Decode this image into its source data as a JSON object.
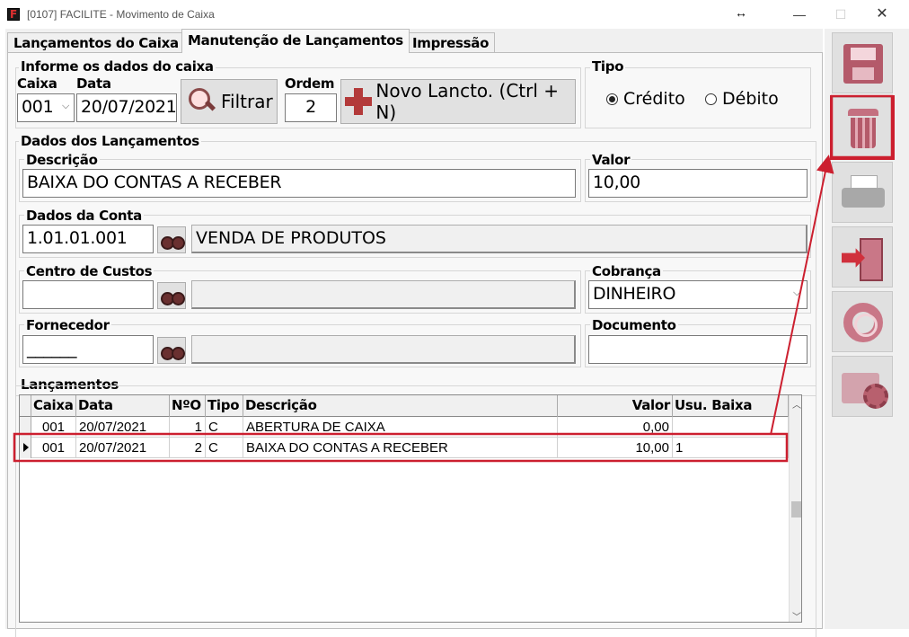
{
  "window": {
    "title": "[0107] FACILITE - Movimento de Caixa",
    "resize_glyph": "↔",
    "minimize": "—",
    "maximize": "☐",
    "close": "✕"
  },
  "tabs": [
    {
      "label": "Lançamentos do Caixa",
      "active": false
    },
    {
      "label": "Manutenção de Lançamentos",
      "active": true
    },
    {
      "label": "Impressão",
      "active": false
    }
  ],
  "caixa_group": {
    "legend": "Informe os dados do caixa",
    "caixa_label": "Caixa",
    "caixa_value": "001",
    "data_label": "Data",
    "data_value": "20/07/2021",
    "filter_button": "Filtrar",
    "ordem_label": "Ordem",
    "ordem_value": "2",
    "new_button": "Novo Lancto. (Ctrl + N)"
  },
  "tipo_group": {
    "legend": "Tipo",
    "options": [
      {
        "label": "Crédito",
        "selected": true
      },
      {
        "label": "Débito",
        "selected": false
      }
    ]
  },
  "lancamento_group": {
    "legend": "Dados dos Lançamentos",
    "descricao_label": "Descrição",
    "descricao_value": "BAIXA DO CONTAS A RECEBER",
    "valor_label": "Valor",
    "valor_value": "10,00",
    "conta_label": "Dados da Conta",
    "conta_code": "1.01.01.001",
    "conta_name": "VENDA DE PRODUTOS",
    "centro_label": "Centro de Custos",
    "centro_code": "",
    "centro_name": "",
    "cobranca_label": "Cobrança",
    "cobranca_value": "DINHEIRO",
    "fornecedor_label": "Fornecedor",
    "fornecedor_code": "______",
    "fornecedor_name": "",
    "documento_label": "Documento",
    "documento_value": ""
  },
  "lancamentos": {
    "legend": "Lançamentos",
    "columns": [
      "Caixa",
      "Data",
      "NºO",
      "Tipo",
      "Descrição",
      "Valor",
      "Usu. Baixa"
    ],
    "rows": [
      {
        "caixa": "001",
        "data": "20/07/2021",
        "ordem": "1",
        "tipo": "C",
        "descricao": "ABERTURA DE CAIXA",
        "valor": "0,00",
        "usuario": "",
        "current": false
      },
      {
        "caixa": "001",
        "data": "20/07/2021",
        "ordem": "2",
        "tipo": "C",
        "descricao": "BAIXA DO CONTAS A RECEBER",
        "valor": "10,00",
        "usuario": "1",
        "current": true
      }
    ]
  },
  "toolbar": {
    "buttons": [
      {
        "icon": "save-icon"
      },
      {
        "icon": "trash-icon",
        "highlighted": true
      },
      {
        "icon": "printer-icon"
      },
      {
        "icon": "exit-icon"
      },
      {
        "icon": "help-icon"
      },
      {
        "icon": "settings-folder-icon"
      }
    ]
  },
  "colors": {
    "annotation": "#cc1f2f",
    "icon_accent": "#b45a6a"
  }
}
